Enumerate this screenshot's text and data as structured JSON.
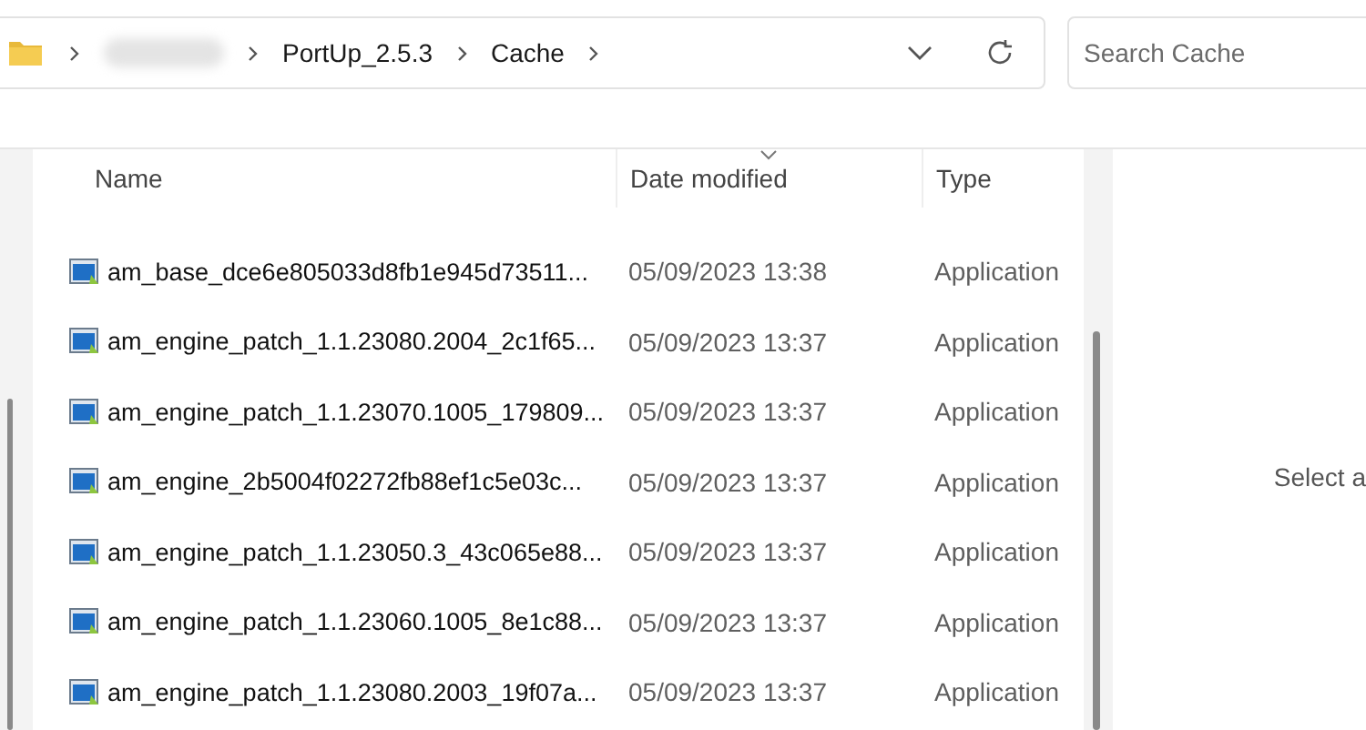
{
  "address_bar": {
    "segments": [
      "PortUp_2.5.3",
      "Cache"
    ]
  },
  "search": {
    "placeholder": "Search Cache"
  },
  "table": {
    "columns": [
      "Name",
      "Date modified",
      "Type"
    ],
    "rows": [
      {
        "name": "am_base_dce6e805033d8fb1e945d73511...",
        "date": "05/09/2023 13:38",
        "type": "Application"
      },
      {
        "name": "am_engine_patch_1.1.23080.2004_2c1f65...",
        "date": "05/09/2023 13:37",
        "type": "Application"
      },
      {
        "name": "am_engine_patch_1.1.23070.1005_179809...",
        "date": "05/09/2023 13:37",
        "type": "Application"
      },
      {
        "name": "am_engine_2b5004f02272fb88ef1c5e03c...",
        "date": "05/09/2023 13:37",
        "type": "Application"
      },
      {
        "name": "am_engine_patch_1.1.23050.3_43c065e88...",
        "date": "05/09/2023 13:37",
        "type": "Application"
      },
      {
        "name": "am_engine_patch_1.1.23060.1005_8e1c88...",
        "date": "05/09/2023 13:37",
        "type": "Application"
      },
      {
        "name": "am_engine_patch_1.1.23080.2003_19f07a...",
        "date": "05/09/2023 13:37",
        "type": "Application"
      }
    ]
  },
  "details_pane": {
    "message": "Select a"
  }
}
